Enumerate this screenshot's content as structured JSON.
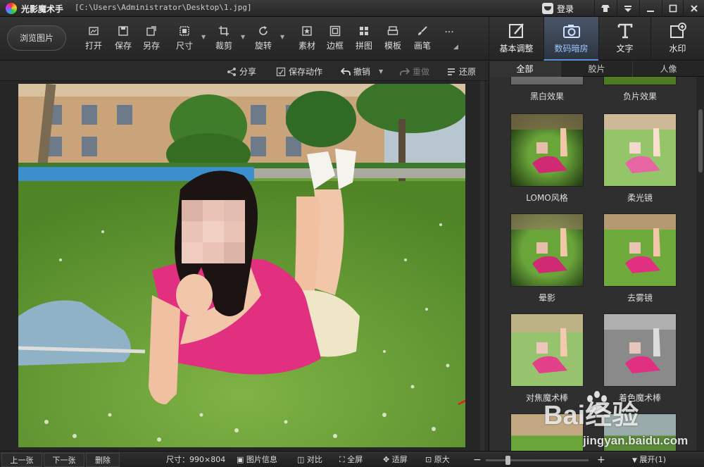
{
  "titlebar": {
    "app_name": "光影魔术手",
    "file_path": "[C:\\Users\\Administrator\\Desktop\\1.jpg]",
    "login_label": "登录",
    "icons": [
      "app-logo",
      "user-face-icon",
      "skin-icon",
      "menu-icon",
      "minimize-icon",
      "maximize-icon",
      "close-icon"
    ]
  },
  "toolbar": {
    "browse_label": "浏览图片",
    "tools": [
      {
        "label": "打开",
        "icon": "open-icon"
      },
      {
        "label": "保存",
        "icon": "save-icon"
      },
      {
        "label": "另存",
        "icon": "save-as-icon"
      },
      {
        "label": "尺寸",
        "icon": "resize-icon"
      },
      {
        "label": "裁剪",
        "icon": "crop-icon"
      },
      {
        "label": "旋转",
        "icon": "rotate-icon"
      },
      {
        "label": "素材",
        "icon": "material-icon"
      },
      {
        "label": "边框",
        "icon": "border-icon"
      },
      {
        "label": "拼图",
        "icon": "collage-icon"
      },
      {
        "label": "模板",
        "icon": "template-icon"
      },
      {
        "label": "画笔",
        "icon": "brush-icon"
      },
      {
        "label": "...",
        "icon": "more-icon"
      }
    ],
    "modes": [
      {
        "label": "基本调整",
        "icon": "basic-adjust-icon",
        "active": false
      },
      {
        "label": "数码暗房",
        "icon": "darkroom-icon",
        "active": true
      },
      {
        "label": "文字",
        "icon": "text-icon",
        "active": false
      },
      {
        "label": "水印",
        "icon": "watermark-icon",
        "active": false
      }
    ]
  },
  "subbar": {
    "share": "分享",
    "save_action": "保存动作",
    "undo": "撤销",
    "redo": "重做",
    "restore": "还原"
  },
  "right_panel": {
    "tabs": [
      "全部",
      "胶片",
      "人像"
    ],
    "active_tab": "全部",
    "effects": [
      {
        "name": "黑白效果",
        "style": "bw"
      },
      {
        "name": "负片效果",
        "style": "negative"
      },
      {
        "name": "LOMO风格",
        "style": "lomo"
      },
      {
        "name": "柔光镜",
        "style": "soft"
      },
      {
        "name": "晕影",
        "style": "vignette"
      },
      {
        "name": "去雾镜",
        "style": "dehaze"
      },
      {
        "name": "对焦魔术棒",
        "style": "focus"
      },
      {
        "name": "着色魔术棒",
        "style": "colorize"
      }
    ]
  },
  "statusbar": {
    "prev": "上一张",
    "next": "下一张",
    "delete": "删除",
    "size_label": "尺寸：990×804",
    "image_info": "图片信息",
    "compare": "对比",
    "fullscreen": "全屏",
    "fit": "适屏",
    "original": "原大",
    "zoom_minus": "−",
    "zoom_plus": "+",
    "expand": "展开(1)"
  },
  "watermark": {
    "brand": "Bai经验",
    "url": "jingyan.baidu.com"
  },
  "colors": {
    "accent": "#5a8fd6",
    "arrow": "#e02020"
  }
}
